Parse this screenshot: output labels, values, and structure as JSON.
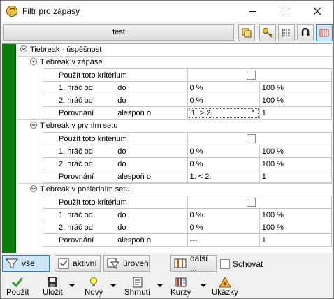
{
  "window": {
    "title": "Filtr pro zápasy",
    "minimize": "—",
    "maximize": "□",
    "close": "✕"
  },
  "toolbar": {
    "preset_label": "test"
  },
  "root": {
    "label": "Tiebreak - úspěšnost"
  },
  "sections": [
    {
      "title": "Tiebreak v zápase",
      "use_label": "Použít toto kritérium",
      "rows": [
        {
          "a": "1. hráč od",
          "b": "do",
          "c": "0 %",
          "d": "100 %"
        },
        {
          "a": "2. hráč od",
          "b": "do",
          "c": "0 %",
          "d": "100 %"
        },
        {
          "a": "Porovnání",
          "b": "alespoň o",
          "c": "1. > 2.",
          "d": "1"
        }
      ]
    },
    {
      "title": "Tiebreak v prvním setu",
      "use_label": "Použít toto kritérium",
      "rows": [
        {
          "a": "1. hráč od",
          "b": "do",
          "c": "0 %",
          "d": "100 %"
        },
        {
          "a": "2. hráč od",
          "b": "do",
          "c": "0 %",
          "d": "100 %"
        },
        {
          "a": "Porovnání",
          "b": "alespoň o",
          "c": "1. < 2.",
          "d": "1"
        }
      ]
    },
    {
      "title": "Tiebreak v posledním setu",
      "use_label": "Použít toto kritérium",
      "rows": [
        {
          "a": "1. hráč od",
          "b": "do",
          "c": "0 %",
          "d": "100 %"
        },
        {
          "a": "2. hráč od",
          "b": "do",
          "c": "0 %",
          "d": "100 %"
        },
        {
          "a": "Porovnání",
          "b": "alespoň o",
          "c": "---",
          "d": "1"
        }
      ]
    }
  ],
  "filterbar": {
    "all": "vše",
    "active": "aktivní",
    "level": "úroveň",
    "more": "další ...",
    "hide": "Schovat"
  },
  "actions": {
    "apply": "Použít",
    "save": "Uložit",
    "new": "Nový",
    "summary": "Shrnutí",
    "rates": "Kurzy",
    "examples": "Ukázky"
  },
  "colors": {
    "green_bar": "#0b7d0b",
    "active_btn": "#cde5f8"
  }
}
